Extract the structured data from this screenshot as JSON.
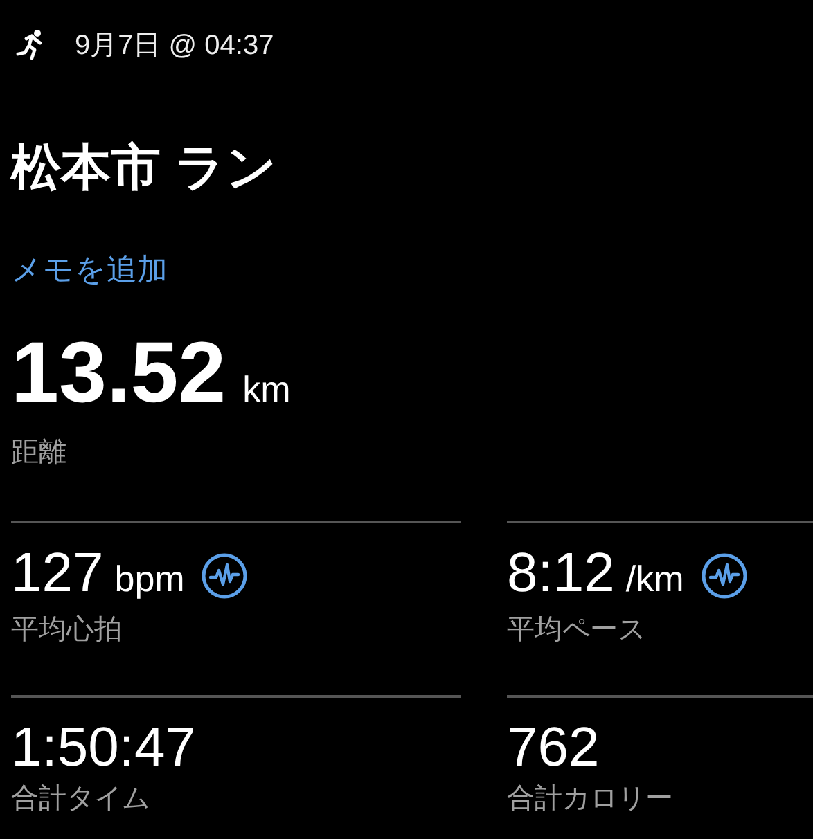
{
  "header": {
    "date": "9月7日 @ 04:37"
  },
  "title": "松本市 ラン",
  "add_note_link": "メモを追加",
  "distance": {
    "value": "13.52",
    "unit": "km",
    "label": "距離"
  },
  "stats": [
    {
      "value": "127",
      "unit": "bpm",
      "label": "平均心拍",
      "chart_link": true
    },
    {
      "value": "8:12",
      "unit": "/km",
      "label": "平均ペース",
      "chart_link": true
    },
    {
      "value": "1:50:47",
      "label": "合計タイム",
      "chart_link": false
    },
    {
      "value": "762",
      "label": "合計カロリー",
      "chart_link": false
    }
  ]
}
